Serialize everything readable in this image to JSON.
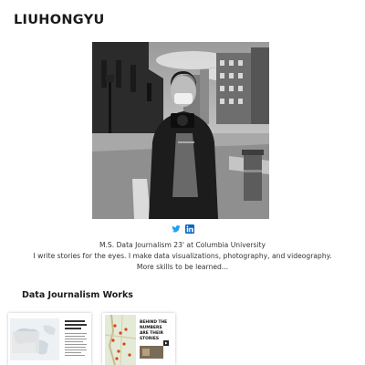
{
  "header": {
    "site_title": "LIUHONGYU"
  },
  "social": {
    "icons": [
      "twitter-icon",
      "linkedin-icon"
    ],
    "twitter_color": "#1da1f2",
    "linkedin_color": "#0a66c2"
  },
  "bio": {
    "line1": "M.S. Data Journalism 23' at Columbia University",
    "line2": "I write stories for the eyes. I make data visualizations, photography, and videography.",
    "line3": "More skills to be learned..."
  },
  "works": {
    "heading": "Data Journalism Works",
    "cards": [
      {
        "title": ""
      },
      {
        "title": "BEHIND THE NUMBERS ARE THEIR STORIES"
      }
    ]
  }
}
